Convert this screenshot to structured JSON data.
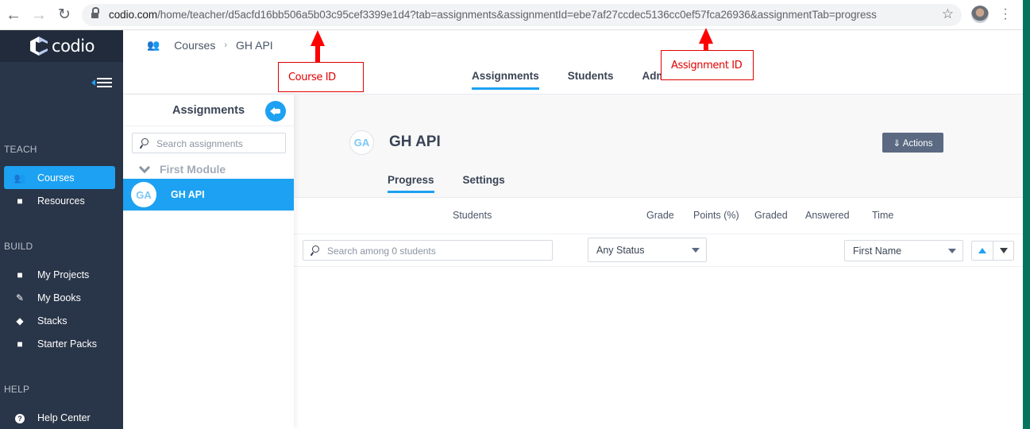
{
  "browser": {
    "url_host": "codio.com",
    "url_path": "/home/teacher/d5acfd16bb506a5b03c95cef3399e1d4?tab=assignments&assignmentId=ebe7af27ccdec5136cc0ef57fca26936&assignmentTab=progress",
    "back_icon": "←",
    "forward_icon": "→",
    "reload_icon": "↻",
    "star_icon": "☆",
    "menu_icon": "⋮"
  },
  "sidebar": {
    "logo_text": "codio",
    "sections": [
      {
        "label": "TEACH",
        "items": [
          {
            "label": "Courses",
            "icon": "users-icon",
            "glyph": "👥",
            "active": true
          },
          {
            "label": "Resources",
            "icon": "folder-icon",
            "glyph": "■",
            "active": false
          }
        ]
      },
      {
        "label": "BUILD",
        "items": [
          {
            "label": "My Projects",
            "icon": "briefcase-icon",
            "glyph": "■"
          },
          {
            "label": "My Books",
            "icon": "edit-icon",
            "glyph": "✎"
          },
          {
            "label": "Stacks",
            "icon": "layers-icon",
            "glyph": "◆"
          },
          {
            "label": "Starter Packs",
            "icon": "package-icon",
            "glyph": "■"
          }
        ]
      },
      {
        "label": "HELP",
        "items": [
          {
            "label": "Help Center",
            "icon": "question-icon",
            "glyph": "?"
          }
        ]
      }
    ]
  },
  "header": {
    "breadcrumb": [
      "Courses",
      "GH API"
    ],
    "breadcrumb_sep": "›",
    "tabs": [
      {
        "label": "Assignments",
        "active": true
      },
      {
        "label": "Students"
      },
      {
        "label": "Admin"
      }
    ]
  },
  "assignments_panel": {
    "title": "Assignments",
    "search_placeholder": "Search assignments",
    "module": "First Module",
    "items": [
      {
        "initials": "GA",
        "name": "GH API",
        "selected": true
      }
    ]
  },
  "assignment": {
    "initials": "GA",
    "title": "GH API",
    "actions_label": "⇓ Actions",
    "tabs": [
      {
        "label": "Progress",
        "active": true
      },
      {
        "label": "Settings"
      }
    ],
    "columns": [
      "Students",
      "Grade",
      "Points (%)",
      "Graded",
      "Answered",
      "Time"
    ],
    "student_search_placeholder": "Search among 0 students",
    "status_filter": "Any Status",
    "sort_field": "First Name"
  },
  "annotations": {
    "course_id": "Course ID",
    "assignment_id": "Assignment ID"
  },
  "colors": {
    "accent": "#1da1f2",
    "sidebar": "#293548",
    "annotation": "#e00000"
  }
}
